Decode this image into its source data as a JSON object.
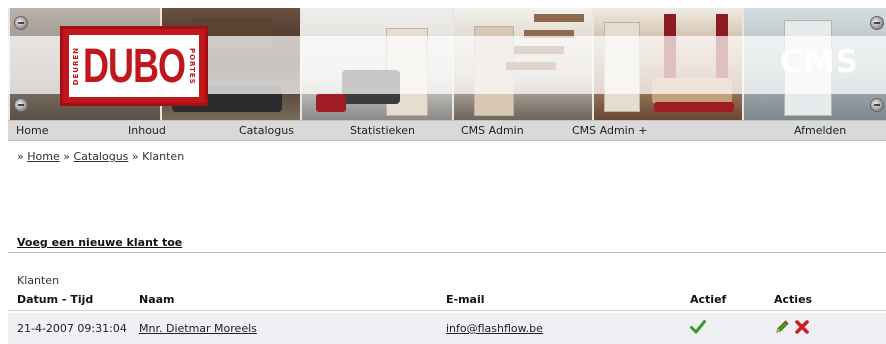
{
  "header": {
    "logo": {
      "main": "DUBO",
      "left": "DEUREN",
      "right": "PORTES"
    },
    "app_label": "CMS"
  },
  "nav": {
    "items": [
      {
        "label": "Home"
      },
      {
        "label": "Inhoud"
      },
      {
        "label": "Catalogus"
      },
      {
        "label": "Statistieken"
      },
      {
        "label": "CMS Admin"
      },
      {
        "label": "CMS Admin +"
      },
      {
        "label": "Afmelden"
      }
    ]
  },
  "breadcrumb": {
    "separator": "»",
    "items": [
      "Home",
      "Catalogus",
      "Klanten"
    ]
  },
  "actions": {
    "add_customer": "Voeg een nieuwe klant toe"
  },
  "customers": {
    "caption": "Klanten",
    "columns": [
      "Datum - Tijd",
      "Naam",
      "E-mail",
      "Actief",
      "Acties"
    ],
    "rows": [
      {
        "datetime": "21-4-2007 09:31:04",
        "name": "Mnr. Dietmar Moreels",
        "email": "info@flashflow.be",
        "active_icon": "checkmark-icon",
        "action_icons": [
          "edit-pencil-icon",
          "delete-x-icon"
        ]
      }
    ]
  },
  "colors": {
    "brand_red": "#c0171c",
    "nav_bg": "#d9d9d9",
    "check_green": "#3a9a2a",
    "delete_red": "#cc1f1f"
  }
}
